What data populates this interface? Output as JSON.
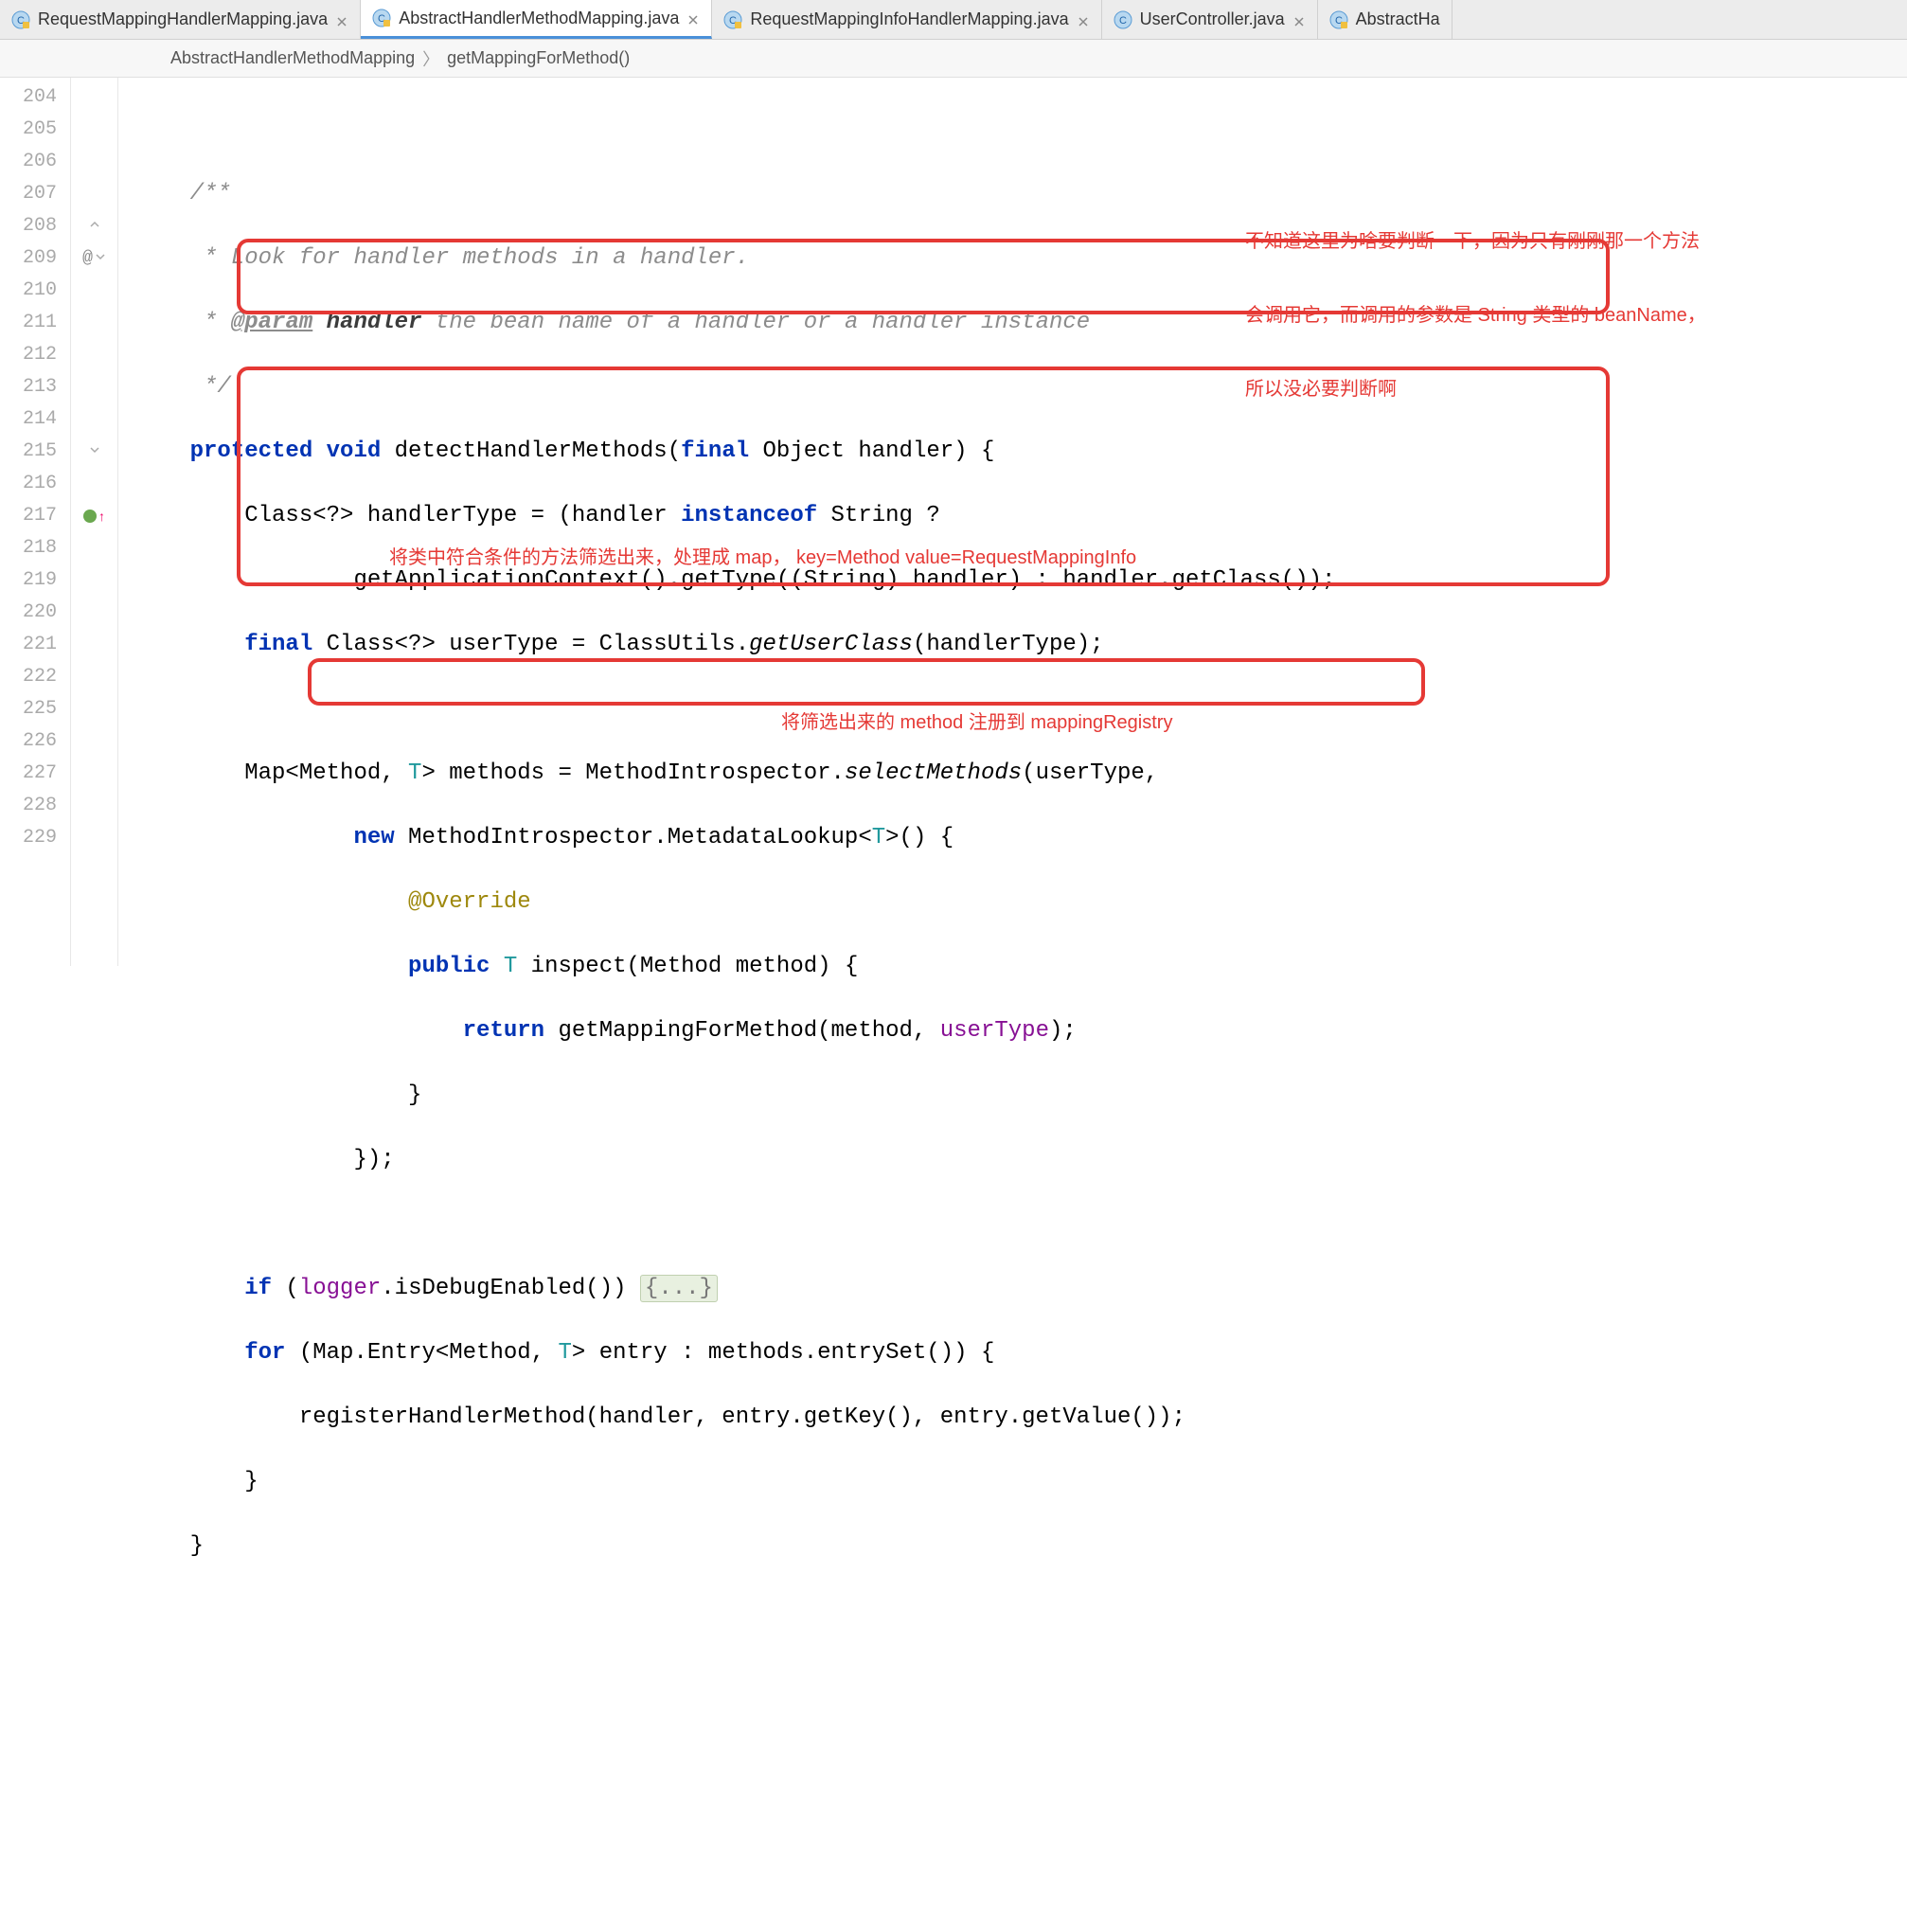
{
  "tabs": [
    {
      "label": "RequestMappingHandlerMapping.java",
      "active": false,
      "locked": true
    },
    {
      "label": "AbstractHandlerMethodMapping.java",
      "active": true,
      "locked": true
    },
    {
      "label": "RequestMappingInfoHandlerMapping.java",
      "active": false,
      "locked": true
    },
    {
      "label": "UserController.java",
      "active": false,
      "locked": false
    },
    {
      "label": "AbstractHa",
      "active": false,
      "locked": true,
      "truncated": true
    }
  ],
  "breadcrumb": {
    "class": "AbstractHandlerMethodMapping",
    "method": "getMappingForMethod()"
  },
  "gutter_lines": [
    "204",
    "205",
    "206",
    "207",
    "208",
    "209",
    "210",
    "211",
    "212",
    "213",
    "214",
    "215",
    "216",
    "217",
    "218",
    "219",
    "220",
    "221",
    "222",
    "225",
    "226",
    "227",
    "228",
    "229"
  ],
  "markers": {
    "209": {
      "at": true,
      "fold": true
    },
    "215": {
      "fold": true
    },
    "217": {
      "impl": true,
      "arrow_up": true
    },
    "208": {
      "fold": true
    }
  },
  "code": {
    "l205": "/**",
    "l206": " * Look for handler methods in a handler.",
    "l207_prefix": " * ",
    "l207_tag": "@param",
    "l207_name": " handler",
    "l207_rest": " the bean name of a handler or a handler instance",
    "l208": " */",
    "l209_a": "protected void",
    "l209_b": " detectHandlerMethods(",
    "l209_c": "final",
    "l209_d": " Object handler) {",
    "l210_a": "    Class<?> handlerType = (handler ",
    "l210_b": "instanceof",
    "l210_c": " String ?",
    "l211": "            getApplicationContext().getType((String) handler) : handler.getClass());",
    "l212_a": "    ",
    "l212_b": "final",
    "l212_c": " Class<?> userType = ClassUtils.",
    "l212_d": "getUserClass",
    "l212_e": "(handlerType);",
    "l214_a": "    Map<Method, ",
    "l214_t": "T",
    "l214_b": "> methods = MethodIntrospector.",
    "l214_c": "selectMethods",
    "l214_d": "(userType,",
    "l215_a": "            ",
    "l215_b": "new",
    "l215_c": " MethodIntrospector.MetadataLookup<",
    "l215_t": "T",
    "l215_d": ">() {",
    "l216_a": "                ",
    "l216_b": "@Override",
    "l217_a": "                ",
    "l217_b": "public",
    "l217_c": " ",
    "l217_t": "T",
    "l217_d": " inspect(Method method) {",
    "l218_a": "                    ",
    "l218_b": "return",
    "l218_c": " getMappingForMethod(method, ",
    "l218_d": "userType",
    "l218_e": ");",
    "l219": "                }",
    "l220": "            });",
    "l222_a": "    ",
    "l222_b": "if",
    "l222_c": " (",
    "l222_d": "logger",
    "l222_e": ".isDebugEnabled()) ",
    "l222_f": "{...}",
    "l225_a": "    ",
    "l225_b": "for",
    "l225_c": " (Map.Entry<Method, ",
    "l225_t": "T",
    "l225_d": "> entry : methods.entrySet()) {",
    "l226": "        registerHandlerMethod(handler, entry.getKey(), entry.getValue());",
    "l227": "    }",
    "l228": "}"
  },
  "annotations": {
    "a1_line1": "不知道这里为啥要判断一下，因为只有刚刚那一个方法",
    "a1_line2": "会调用它，而调用的参数是 String 类型的 beanName，",
    "a1_line3": "所以没必要判断啊",
    "a2": "将类中符合条件的方法筛选出来，处理成 map， key=Method value=RequestMappingInfo",
    "a3": "将筛选出来的 method 注册到 mappingRegistry"
  }
}
